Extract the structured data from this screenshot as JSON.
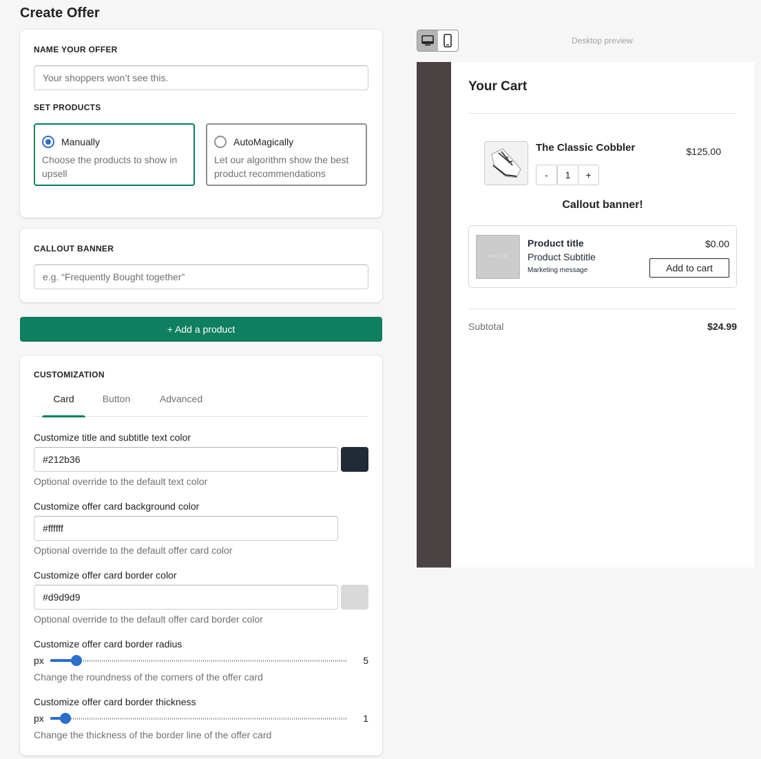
{
  "page": {
    "title": "Create Offer"
  },
  "name_section": {
    "heading": "NAME YOUR OFFER",
    "input_placeholder": "Your shoppers won’t see this.",
    "input_value": ""
  },
  "products_section": {
    "heading": "SET PRODUCTS",
    "options": [
      {
        "label": "Manually",
        "description": "Choose the products to show in upsell",
        "selected": true
      },
      {
        "label": "AutoMagically",
        "description": "Let our algorithm show the best product recommendations",
        "selected": false
      }
    ]
  },
  "callout_section": {
    "heading": "CALLOUT BANNER",
    "input_placeholder": "e.g. “Frequently Bought together”",
    "input_value": ""
  },
  "add_product_button": {
    "label": "+ Add a product"
  },
  "customization": {
    "heading": "CUSTOMIZATION",
    "tabs": [
      {
        "label": "Card",
        "active": true
      },
      {
        "label": "Button",
        "active": false
      },
      {
        "label": "Advanced",
        "active": false
      }
    ],
    "text_color": {
      "label": "Customize title and subtitle text color",
      "value": "#212b36",
      "help": "Optional override to the default text color",
      "swatch": "#212b36"
    },
    "bg_color": {
      "label": "Customize offer card background color",
      "value": "#ffffff",
      "help": "Optional override to the default offer card color",
      "swatch": "#ffffff"
    },
    "border_color": {
      "label": "Customize offer card border color",
      "value": "#d9d9d9",
      "help": "Optional override to the default offer card border color",
      "swatch": "#d9d9d9"
    },
    "border_radius": {
      "label": "Customize offer card border radius",
      "prefix": "px",
      "value": "5",
      "level": 0.065,
      "help": "Change the roundness of the corners of the offer card"
    },
    "border_thickness": {
      "label": "Customize offer card border thickness",
      "prefix": "px",
      "value": "1",
      "level": 0.025,
      "help": "Change the thickness of the border line of the offer card"
    }
  },
  "preview": {
    "label": "Desktop preview",
    "device_icons": [
      "desktop-icon",
      "mobile-icon"
    ],
    "sidebar_color": "#4b4244",
    "cart": {
      "title": "Your Cart",
      "product": {
        "title": "The Classic Cobbler",
        "price": "$125.00",
        "qty": "1",
        "minus": "-",
        "plus": "+"
      },
      "callout": "Callout banner!",
      "offer": {
        "title": "Product title",
        "subtitle": "Product Subtitle",
        "message": "Marketing message",
        "price": "$0.00",
        "button": "Add to cart",
        "image_text": "200 × 200"
      },
      "subtotal_label": "Subtotal",
      "subtotal_value": "$24.99"
    }
  },
  "colors": {
    "primary": "#0e7f5f",
    "accent": "#2c6ecb",
    "selected_border": "#008060"
  }
}
